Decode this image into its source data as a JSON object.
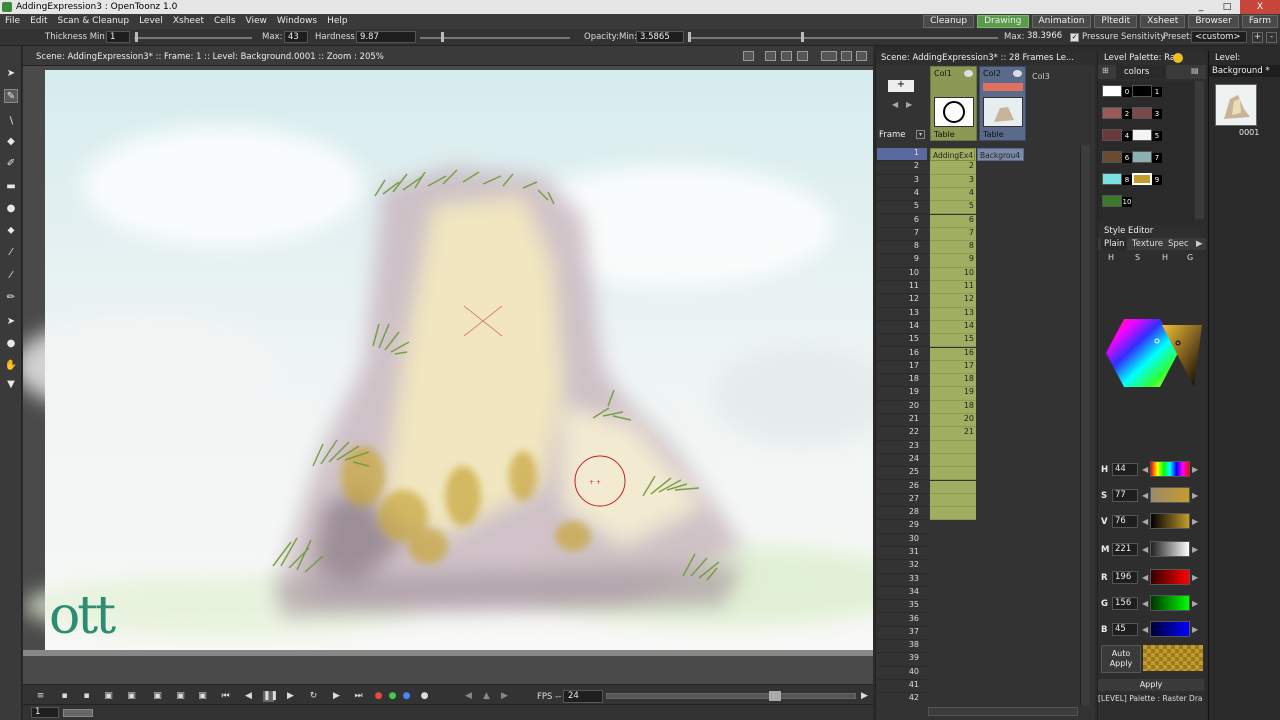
{
  "window": {
    "title": "AddingExpression3 : OpenToonz 1.0",
    "controls": [
      "_",
      "□",
      "X"
    ]
  },
  "menu": [
    "File",
    "Edit",
    "Scan & Cleanup",
    "Level",
    "Xsheet",
    "Cells",
    "View",
    "Windows",
    "Help"
  ],
  "rooms": [
    {
      "label": "Cleanup",
      "active": false
    },
    {
      "label": "Drawing",
      "active": true
    },
    {
      "label": "Animation",
      "active": false
    },
    {
      "label": "Pltedit",
      "active": false
    },
    {
      "label": "Xsheet",
      "active": false
    },
    {
      "label": "Browser",
      "active": false
    },
    {
      "label": "Farm",
      "active": false
    }
  ],
  "tool_options": {
    "thickness_min_label": "Thickness Min:",
    "thickness_min": "1",
    "max_label": "Max:",
    "thickness_max": "43",
    "hardness_label": "Hardness:",
    "hardness": "9.87",
    "opacity_min_label": "Opacity:Min:",
    "opacity_min": "3.5865",
    "opacity_max_label": "Max:",
    "opacity_max": "38.3966",
    "pressure_label": "Pressure Sensitivity",
    "pressure_checked": true,
    "preset_label": "Preset:",
    "preset_value": "<custom>"
  },
  "viewer": {
    "info": "Scene: AddingExpression3*  ::  Frame: 1  ::  Level: Background.0001  ::  Zoom : 205%",
    "watermark": "ott",
    "frame_field": "1",
    "fps_label": "FPS -- /",
    "fps_value": "24"
  },
  "xsheet": {
    "header": "Scene: AddingExpression3*  ::  28 Frames  Le...",
    "frame_label": "Frame",
    "columns": [
      {
        "name": "Col1",
        "kind": "Table",
        "level": "AddingEx4",
        "color": "#8a9a55"
      },
      {
        "name": "Col2",
        "kind": "Table",
        "level": "Backgrou4",
        "color": "#5a6a8a"
      },
      {
        "name": "Col3",
        "kind": "",
        "level": "",
        "color": ""
      }
    ],
    "col1_cells": [
      "1",
      "2",
      "3",
      "4",
      "5",
      "6",
      "7",
      "8",
      "9",
      "10",
      "11",
      "12",
      "13",
      "14",
      "15",
      "16",
      "17",
      "18",
      "19",
      "18",
      "20",
      "21"
    ],
    "total_rows": 42
  },
  "level_palette": {
    "title": "Level Palette: Ra",
    "page": "colors",
    "styles": [
      {
        "id": "0",
        "color": "#ffffff"
      },
      {
        "id": "1",
        "color": "#000000"
      },
      {
        "id": "2",
        "color": "#9a5a5a"
      },
      {
        "id": "3",
        "color": "#7a4a4a"
      },
      {
        "id": "4",
        "color": "#6a3a3a"
      },
      {
        "id": "5",
        "color": "#f4f4f4"
      },
      {
        "id": "6",
        "color": "#6a4a30"
      },
      {
        "id": "7",
        "color": "#8ab0b0"
      },
      {
        "id": "8",
        "color": "#7ae0e0"
      },
      {
        "id": "9",
        "color": "#c49c2d"
      },
      {
        "id": "10",
        "color": "#3a7a2a"
      }
    ]
  },
  "level_strip": {
    "title": "Level:",
    "level": "Background *",
    "frame": "0001"
  },
  "style_editor": {
    "title": "Style Editor",
    "tabs": [
      "Plain",
      "Texture",
      "Spec"
    ],
    "modes": [
      "H",
      "S",
      "H",
      "G"
    ],
    "channels": [
      {
        "label": "H",
        "value": "44"
      },
      {
        "label": "S",
        "value": "77"
      },
      {
        "label": "V",
        "value": "76"
      },
      {
        "label": "M",
        "value": "221"
      },
      {
        "label": "R",
        "value": "196"
      },
      {
        "label": "G",
        "value": "156"
      },
      {
        "label": "B",
        "value": "45"
      }
    ],
    "auto_apply": "Auto\nApply",
    "apply": "Apply",
    "current_color": "#c49c2d",
    "status": "[LEVEL]  Palette : Raster Dra"
  }
}
